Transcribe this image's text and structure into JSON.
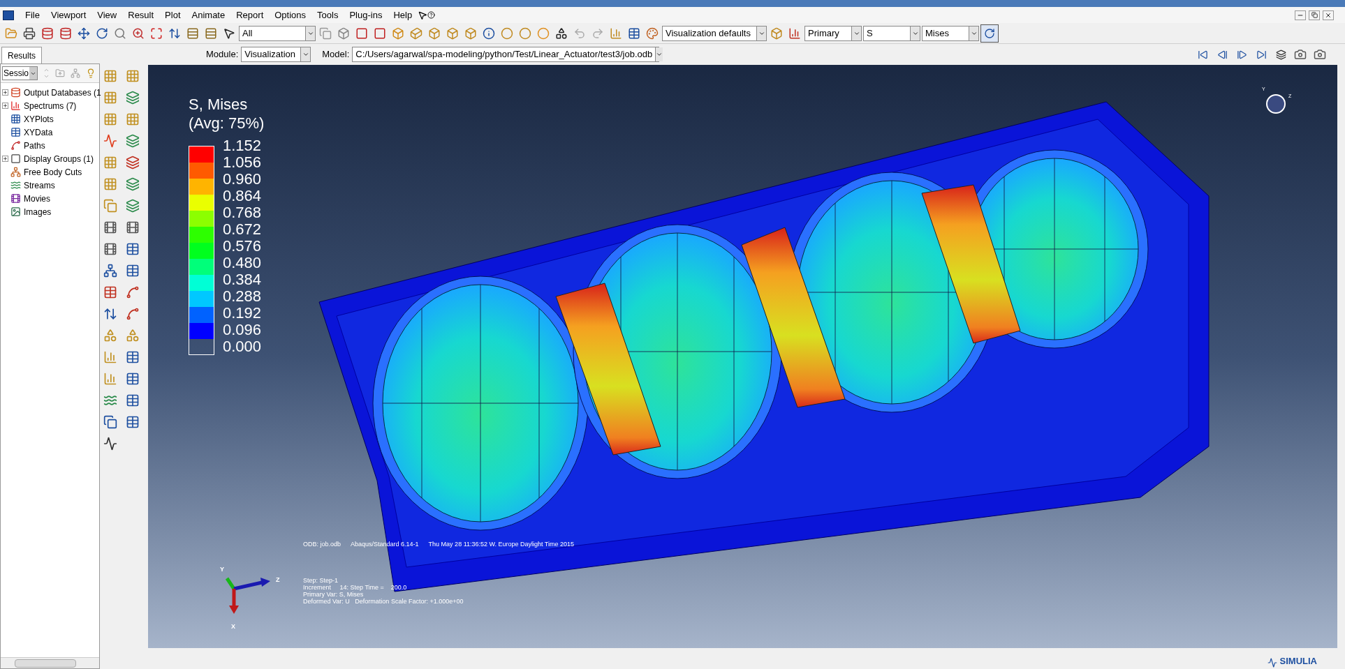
{
  "menu_bar": {
    "items": [
      "File",
      "Viewport",
      "View",
      "Result",
      "Plot",
      "Animate",
      "Report",
      "Options",
      "Tools",
      "Plug-ins",
      "Help"
    ]
  },
  "toolbar": {
    "selection_filter": "All",
    "color_code": "Visualization defaults",
    "field_output": {
      "position": "Primary",
      "variable": "S",
      "invariant": "Mises"
    }
  },
  "context_bar": {
    "module_label": "Module:",
    "module": "Visualization",
    "model_label": "Model:",
    "model": "C:/Users/agarwal/spa-modeling/python/Test/Linear_Actuator/test3/job.odb"
  },
  "left_panel": {
    "tab": {
      "label": "Results",
      "selected": true
    },
    "session_combo": "Sessio",
    "tree": [
      {
        "label": "Output Databases (1",
        "expandable": true
      },
      {
        "label": "Spectrums (7)",
        "expandable": true
      },
      {
        "label": "XYPlots",
        "expandable": false
      },
      {
        "label": "XYData",
        "expandable": false
      },
      {
        "label": "Paths",
        "expandable": false
      },
      {
        "label": "Display Groups (1)",
        "expandable": true
      },
      {
        "label": "Free Body Cuts",
        "expandable": false
      },
      {
        "label": "Streams",
        "expandable": false
      },
      {
        "label": "Movies",
        "expandable": false
      },
      {
        "label": "Images",
        "expandable": false
      }
    ]
  },
  "legend": {
    "title": "S, Mises",
    "subtitle": "(Avg: 75%)",
    "bands": [
      {
        "color": "#ff0000"
      },
      {
        "color": "#ff5a00"
      },
      {
        "color": "#ffb400"
      },
      {
        "color": "#eaff00"
      },
      {
        "color": "#8cff00"
      },
      {
        "color": "#2dff00"
      },
      {
        "color": "#00ff1e"
      },
      {
        "color": "#00ff7a"
      },
      {
        "color": "#00ffd6"
      },
      {
        "color": "#00c8ff"
      },
      {
        "color": "#0062ff"
      },
      {
        "color": "#0000ff"
      }
    ],
    "labels": [
      "1.152",
      "1.056",
      "0.960",
      "0.864",
      "0.768",
      "0.672",
      "0.576",
      "0.480",
      "0.384",
      "0.288",
      "0.192",
      "0.096",
      "0.000"
    ]
  },
  "viewport_info": {
    "header": [
      "ODB: job.odb",
      "Abaqus/Standard 6.14-1",
      "Thu May 28 11:36:52 W. Europe Daylight Time 2015"
    ],
    "lines": [
      "Step: Step-1",
      "Increment     14: Step Time =    200.0",
      "Primary Var: S, Mises",
      "Deformed Var: U   Deformation Scale Factor: +1.000e+00"
    ]
  },
  "triad": {
    "x": "X",
    "y": "Y",
    "z": "Z"
  },
  "view_triad": {
    "y": "Y",
    "z": "Z"
  },
  "brand": "SIMULIA"
}
